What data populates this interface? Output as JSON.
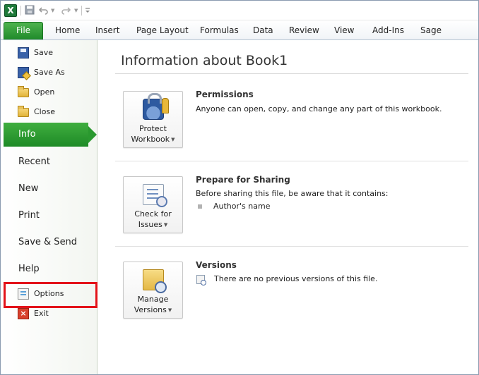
{
  "qat": {
    "app_icon_letter": "X",
    "icons": [
      "excel-icon",
      "save-icon",
      "undo-icon",
      "redo-icon",
      "customize-icon"
    ]
  },
  "ribbon": {
    "file_tab": "File",
    "tabs": [
      "Home",
      "Insert",
      "Page Layout",
      "Formulas",
      "Data",
      "Review",
      "View",
      "Add-Ins",
      "Sage"
    ]
  },
  "nav": {
    "save": "Save",
    "save_as": "Save As",
    "open": "Open",
    "close": "Close",
    "info": "Info",
    "recent": "Recent",
    "new": "New",
    "print": "Print",
    "save_send": "Save & Send",
    "help": "Help",
    "options": "Options",
    "exit": "Exit"
  },
  "main": {
    "title": "Information about Book1",
    "permissions": {
      "button_line1": "Protect",
      "button_line2": "Workbook",
      "heading": "Permissions",
      "text": "Anyone can open, copy, and change any part of this workbook."
    },
    "sharing": {
      "button_line1": "Check for",
      "button_line2": "Issues",
      "heading": "Prepare for Sharing",
      "text": "Before sharing this file, be aware that it contains:",
      "bullet": "Author's name"
    },
    "versions": {
      "button_line1": "Manage",
      "button_line2": "Versions",
      "heading": "Versions",
      "text": "There are no previous versions of this file."
    }
  },
  "colors": {
    "accent_green": "#1f8a2a",
    "highlight_red": "#e3131a"
  }
}
